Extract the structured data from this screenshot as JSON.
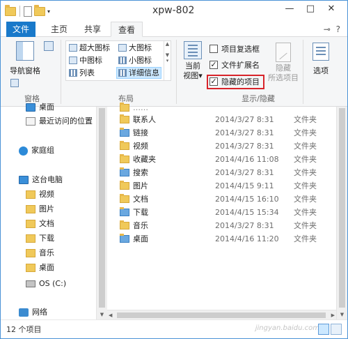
{
  "window": {
    "title": "xpw-802"
  },
  "title_buttons": {
    "minimize": "—",
    "maximize": "□",
    "close": "✕"
  },
  "tabs": [
    {
      "label": "文件"
    },
    {
      "label": "主页"
    },
    {
      "label": "共享"
    },
    {
      "label": "查看"
    }
  ],
  "tabs_right": "⊸ ?",
  "ribbon": {
    "panes": {
      "nav_pane": "导航窗格",
      "group_label": "窗格"
    },
    "layout": {
      "items": [
        "超大图标",
        "大图标",
        "中图标",
        "小图标",
        "列表",
        "详细信息"
      ],
      "group_label": "布局"
    },
    "current_view": {
      "line1": "当前",
      "line2": "视图",
      "arrow": "▾"
    },
    "show_hide": {
      "item_checkbox": "项目复选框",
      "file_ext": "文件扩展名",
      "hidden_items": "隐藏的项目",
      "hide_line1": "隐藏",
      "hide_line2": "所选项目",
      "group_label": "显示/隐藏"
    },
    "options": "选项"
  },
  "nav": [
    {
      "label": "桌面",
      "icon": "desktop-icon"
    },
    {
      "label": "最近访问的位置",
      "icon": "recent-icon"
    },
    {
      "label": "家庭组",
      "icon": "homegroup-icon"
    },
    {
      "label": "这台电脑",
      "icon": "pc-icon"
    },
    {
      "label": "视频",
      "icon": "folder-icon"
    },
    {
      "label": "图片",
      "icon": "folder-icon"
    },
    {
      "label": "文档",
      "icon": "folder-icon"
    },
    {
      "label": "下载",
      "icon": "folder-icon"
    },
    {
      "label": "音乐",
      "icon": "folder-icon"
    },
    {
      "label": "桌面",
      "icon": "folder-icon"
    },
    {
      "label": "OS (C:)",
      "icon": "disk-icon"
    },
    {
      "label": "网络",
      "icon": "network-icon"
    }
  ],
  "files": [
    {
      "name": "联系人",
      "date": "2014/3/27 8:31",
      "type": "文件夹"
    },
    {
      "name": "链接",
      "date": "2014/3/27 8:31",
      "type": "文件夹"
    },
    {
      "name": "视频",
      "date": "2014/3/27 8:31",
      "type": "文件夹"
    },
    {
      "name": "收藏夹",
      "date": "2014/4/16 11:08",
      "type": "文件夹"
    },
    {
      "name": "搜索",
      "date": "2014/3/27 8:31",
      "type": "文件夹"
    },
    {
      "name": "图片",
      "date": "2014/4/15 9:11",
      "type": "文件夹"
    },
    {
      "name": "文档",
      "date": "2014/4/15 16:10",
      "type": "文件夹"
    },
    {
      "name": "下载",
      "date": "2014/4/15 15:34",
      "type": "文件夹"
    },
    {
      "name": "音乐",
      "date": "2014/3/27 8:31",
      "type": "文件夹"
    },
    {
      "name": "桌面",
      "date": "2014/4/16 11:20",
      "type": "文件夹"
    }
  ],
  "status": {
    "count": "12 个项目"
  },
  "watermark": "jingyan.baidu.com"
}
